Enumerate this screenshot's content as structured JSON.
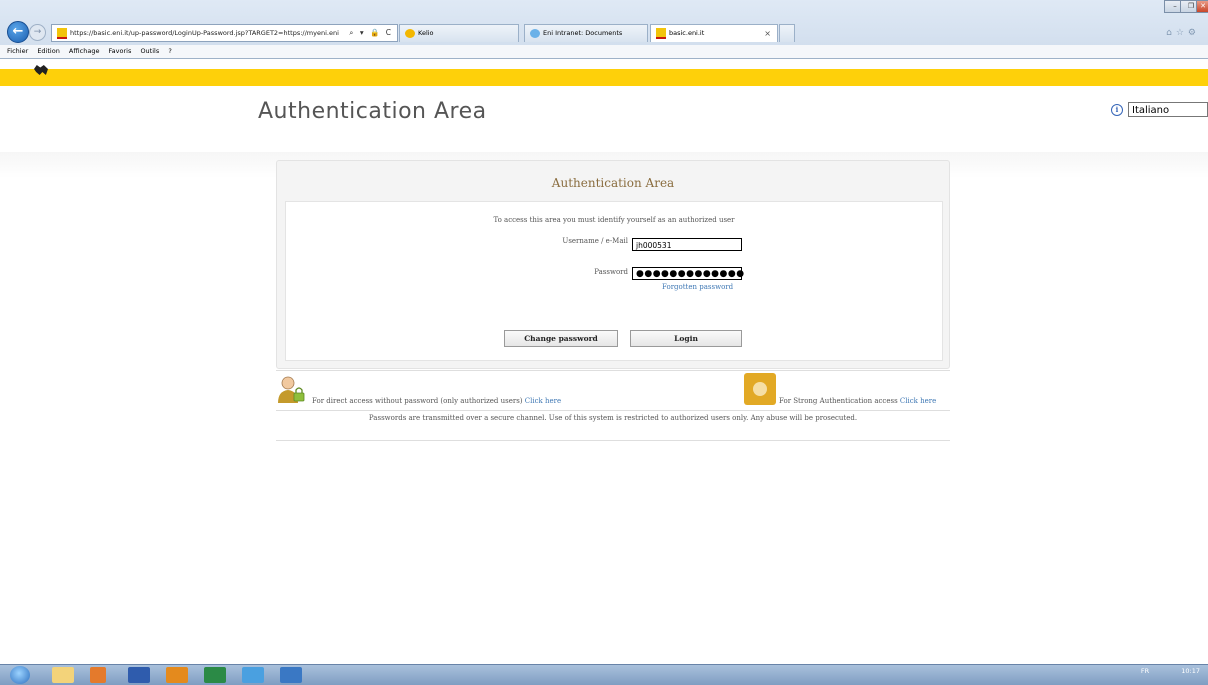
{
  "browser": {
    "address_url": "https://basic.eni.it/up-password/LoginUp-Password.jsp?TARGET2=https://myeni.eni",
    "address_controls": "⌕ ▾ 🔒 C",
    "tabs": [
      {
        "label": "Kelio"
      },
      {
        "label": "Eni Intranet: Documents"
      },
      {
        "label": "basic.eni.it",
        "close": "×"
      }
    ],
    "menu": [
      "Fichier",
      "Edition",
      "Affichage",
      "Favoris",
      "Outils",
      "?"
    ],
    "window_controls": [
      "–",
      "❐",
      "✕"
    ]
  },
  "header": {
    "title": "Authentication Area",
    "language_selected": "Italiano",
    "info_icon": "i"
  },
  "auth_panel": {
    "title": "Authentication Area",
    "intro": "To access this area you must identify yourself as an authorized user",
    "username_label": "Username / e-Mail",
    "username_value": "jh000531",
    "password_label": "Password",
    "password_value": "●●●●●●●●●●●●●",
    "forgot_link": "Forgotten password",
    "change_password_button": "Change password",
    "login_button": "Login"
  },
  "access_options": {
    "direct_text": "For direct access without password (only authorized users)",
    "direct_link": "Click here",
    "strong_text": "For Strong Authentication access",
    "strong_link": "Click here",
    "security_note": "Passwords are transmitted over a secure channel. Use of this system is restricted to authorized users only. Any abuse will be prosecuted."
  },
  "taskbar": {
    "tray_lang": "FR",
    "clock": "10:17"
  },
  "colors": {
    "eni_yellow": "#fed00a",
    "link_blue": "#3f78b4",
    "panel_title": "#8a6d3f"
  }
}
